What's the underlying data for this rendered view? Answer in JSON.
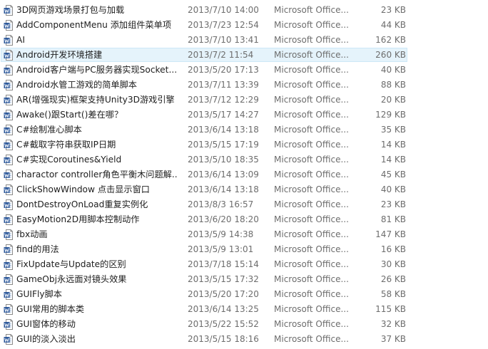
{
  "files": [
    {
      "name": "3D网页游戏场景打包与加载",
      "date": "2013/7/10 14:00",
      "type": "Microsoft Office...",
      "size": "23 KB"
    },
    {
      "name": "AddComponentMenu 添加组件菜单项",
      "date": "2013/7/23 12:54",
      "type": "Microsoft Office...",
      "size": "44 KB"
    },
    {
      "name": "AI",
      "date": "2013/7/10 13:41",
      "type": "Microsoft Office...",
      "size": "162 KB"
    },
    {
      "name": "Android开发环境搭建",
      "date": "2013/7/2 11:54",
      "type": "Microsoft Office...",
      "size": "260 KB",
      "selected": true
    },
    {
      "name": "Android客户端与PC服务器实现Socket...",
      "date": "2013/5/20 17:13",
      "type": "Microsoft Office...",
      "size": "40 KB"
    },
    {
      "name": "Android水管工游戏的简单脚本",
      "date": "2013/7/11 13:39",
      "type": "Microsoft Office...",
      "size": "88 KB"
    },
    {
      "name": "AR(增强现实)框架支持Unity3D游戏引擎",
      "date": "2013/7/12 12:29",
      "type": "Microsoft Office...",
      "size": "20 KB"
    },
    {
      "name": "Awake()跟Start()差在哪？",
      "date": "2013/5/17 14:27",
      "type": "Microsoft Office...",
      "size": "129 KB"
    },
    {
      "name": "C#绘制准心脚本",
      "date": "2013/6/14 13:18",
      "type": "Microsoft Office...",
      "size": "35 KB"
    },
    {
      "name": "C#截取字符串获取IP日期",
      "date": "2013/5/15 17:19",
      "type": "Microsoft Office...",
      "size": "14 KB"
    },
    {
      "name": "C#实现Coroutines&Yield",
      "date": "2013/5/10 18:35",
      "type": "Microsoft Office...",
      "size": "14 KB"
    },
    {
      "name": "charactor controller角色平衡木问题解...",
      "date": "2013/6/14 13:09",
      "type": "Microsoft Office...",
      "size": "45 KB"
    },
    {
      "name": "ClickShowWindow 点击显示窗口",
      "date": "2013/6/14 13:18",
      "type": "Microsoft Office...",
      "size": "40 KB"
    },
    {
      "name": "DontDestroyOnLoad重复实例化",
      "date": "2013/8/3 16:57",
      "type": "Microsoft Office...",
      "size": "23 KB"
    },
    {
      "name": "EasyMotion2D用脚本控制动作",
      "date": "2013/6/20 18:20",
      "type": "Microsoft Office...",
      "size": "81 KB"
    },
    {
      "name": "fbx动画",
      "date": "2013/5/9 14:38",
      "type": "Microsoft Office...",
      "size": "147 KB"
    },
    {
      "name": "find的用法",
      "date": "2013/5/9 13:01",
      "type": "Microsoft Office...",
      "size": "16 KB"
    },
    {
      "name": "FixUpdate与Update的区别",
      "date": "2013/7/18 15:14",
      "type": "Microsoft Office...",
      "size": "30 KB"
    },
    {
      "name": "GameObj永远面对镜头效果",
      "date": "2013/5/15 17:32",
      "type": "Microsoft Office...",
      "size": "26 KB"
    },
    {
      "name": "GUIFly脚本",
      "date": "2013/5/20 17:20",
      "type": "Microsoft Office...",
      "size": "58 KB"
    },
    {
      "name": "GUI常用的脚本类",
      "date": "2013/6/14 13:25",
      "type": "Microsoft Office...",
      "size": "115 KB"
    },
    {
      "name": "GUI窗体的移动",
      "date": "2013/5/22 15:52",
      "type": "Microsoft Office...",
      "size": "32 KB"
    },
    {
      "name": "GUI的淡入淡出",
      "date": "2013/5/15 18:16",
      "type": "Microsoft Office...",
      "size": "37 KB"
    }
  ],
  "icon": "word-document-icon",
  "colors": {
    "selection_fill": "#e5f3fb",
    "selection_border": "#cde8f7",
    "word_blue": "#2b579a",
    "detail_text": "#6d6d6d"
  }
}
